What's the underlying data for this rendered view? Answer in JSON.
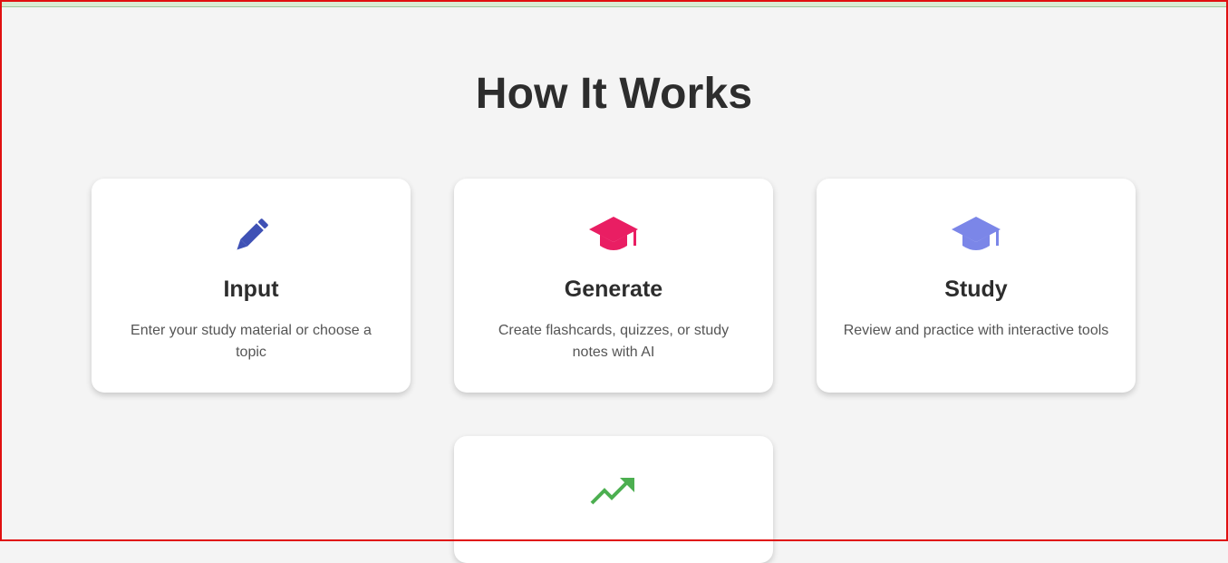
{
  "section": {
    "title": "How It Works"
  },
  "steps": [
    {
      "title": "Input",
      "description": "Enter your study material or choose a topic",
      "icon": "pencil-icon",
      "color": "#3f51b5"
    },
    {
      "title": "Generate",
      "description": "Create flashcards, quizzes, or study notes with AI",
      "icon": "graduation-cap-icon",
      "color": "#e91e63"
    },
    {
      "title": "Study",
      "description": "Review and practice with interactive tools",
      "icon": "graduation-cap-icon",
      "color": "#7b86e8"
    },
    {
      "title": "",
      "description": "",
      "icon": "trending-up-icon",
      "color": "#4caf50"
    }
  ]
}
